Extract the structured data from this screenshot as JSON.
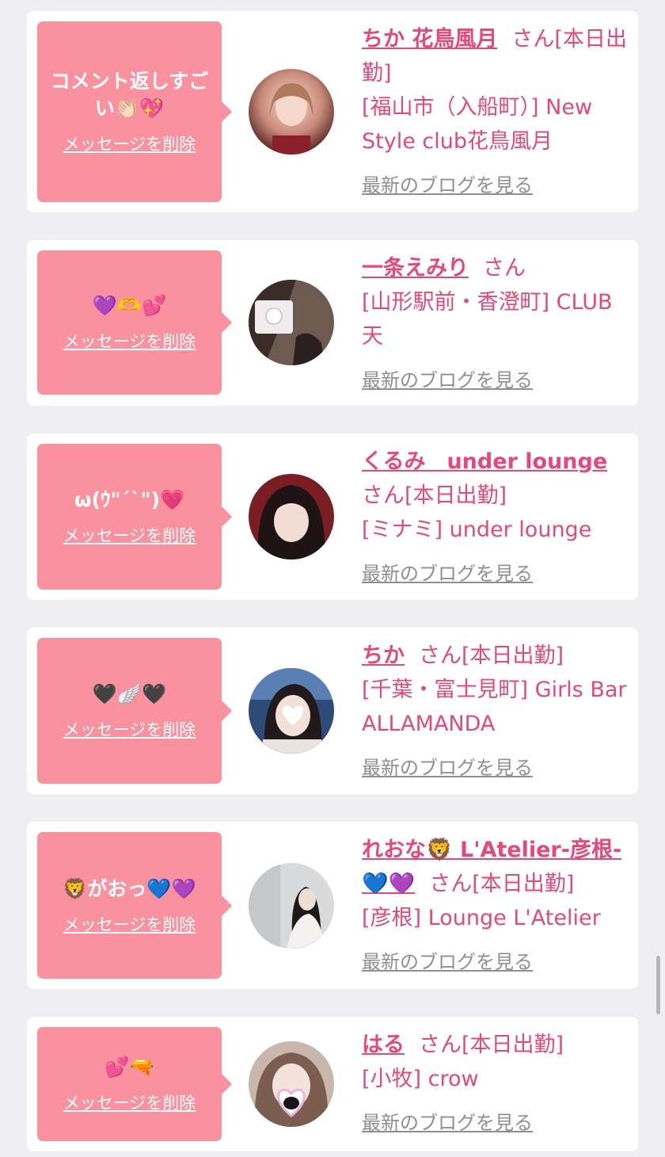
{
  "delete_label": "メッセージを削除",
  "blog_label": "最新のブログを見る",
  "colors": {
    "accent": "#e64879",
    "bubble": "#f9919e",
    "background": "#efeff1"
  },
  "cards": [
    {
      "comment": "コメント返しすごい👏🏻💖",
      "name": "ちか 花鳥風月",
      "san": "さん[本日出勤]",
      "shop": "[福山市（入船町）] New Style club花鳥風月"
    },
    {
      "comment": "💜🫶💕",
      "name": "一条えみり",
      "san": "さん",
      "shop": "[山形駅前・香澄町] CLUB 天"
    },
    {
      "comment": "ω(ｳ\"ˊˋ\")💗",
      "name": "くるみ　under lounge",
      "san": "さん[本日出勤]",
      "shop": "[ミナミ] under lounge"
    },
    {
      "comment": "🖤🪽🖤",
      "name": "ちか",
      "san": "さん[本日出勤]",
      "shop": "[千葉・富士見町] Girls Bar ALLAMANDA"
    },
    {
      "comment": "🦁がおっ💙💜",
      "name": "れおな🦁 L'Atelier-彦根-💙💜",
      "san": "さん[本日出勤]",
      "shop": "[彦根] Lounge L'Atelier"
    },
    {
      "comment": "💕🔫",
      "name": "はる",
      "san": "さん[本日出勤]",
      "shop": "[小牧] crow"
    }
  ]
}
